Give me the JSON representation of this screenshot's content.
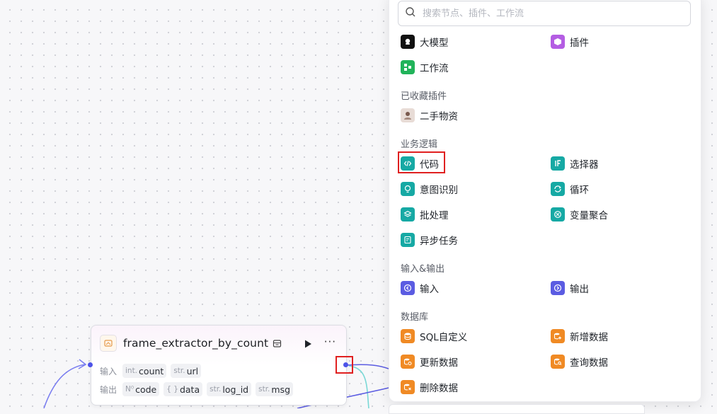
{
  "node": {
    "title": "frame_extractor_by_count",
    "input_label": "输入",
    "output_label": "输出",
    "inputs": [
      {
        "type": "int.",
        "name": "count"
      },
      {
        "type": "str.",
        "name": "url"
      }
    ],
    "outputs": [
      {
        "type": "N⁰",
        "name": "code"
      },
      {
        "type": "{ }",
        "name": "data"
      },
      {
        "type": "str.",
        "name": "log_id"
      },
      {
        "type": "str.",
        "name": "msg"
      }
    ],
    "run_icon": "play-icon",
    "more_icon": "more-icon",
    "more_label": "···"
  },
  "panel": {
    "search_placeholder": "搜索节点、插件、工作流",
    "top_items": [
      "大模型",
      "插件",
      "工作流"
    ],
    "sections": {
      "favorites": "已收藏插件",
      "logic": "业务逻辑",
      "io": "输入&输出",
      "database": "数据库"
    },
    "favorites": [
      "二手物资"
    ],
    "logic_items": [
      "代码",
      "选择器",
      "意图识别",
      "循环",
      "批处理",
      "变量聚合",
      "异步任务"
    ],
    "io_items": [
      "输入",
      "输出"
    ],
    "db_items": [
      "SQL自定义",
      "新增数据",
      "更新数据",
      "查询数据",
      "删除数据"
    ]
  },
  "colors": {
    "accent": "#4d53e8",
    "teal": "#16a9a4",
    "orange": "#f08a24",
    "highlight": "#e02020"
  }
}
